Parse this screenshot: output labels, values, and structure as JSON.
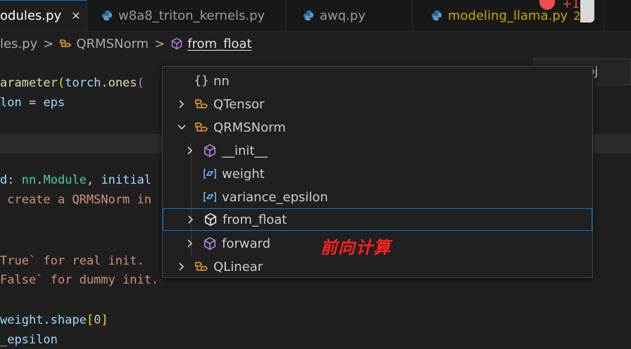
{
  "tabs": [
    {
      "label": "odules.py",
      "active": true,
      "close": "✕"
    },
    {
      "label": "w8a8_triton_kernels.py"
    },
    {
      "label": "awq.py"
    },
    {
      "label": "modeling_llama.py",
      "badge": "2"
    }
  ],
  "notification": {
    "plus": "+1"
  },
  "breadcrumb": {
    "file": "les.py",
    "class": "QRMSNorm",
    "current": "from_float",
    "sep": ">"
  },
  "minimap_label": "oj",
  "code": {
    "l1a": "arameter",
    "l1b": "(",
    "l1c": "torch",
    "l1d": ".",
    "l1e": "ones",
    "l1f": "(",
    "l2a": "lon",
    "l2b": " = ",
    "l2c": "eps",
    "l4a": "d",
    "l4b": ": ",
    "l4c": "nn",
    "l4d": ".",
    "l4e": "Module",
    "l4f": ", ",
    "l4g": "initial",
    "l5": " create a QRMSNorm in",
    "l7": "True` for real init.",
    "l8": "False` for dummy init.",
    "l10a": "weight",
    "l10b": ".",
    "l10c": "shape",
    "l10d": "[",
    "l10e": "0",
    "l10f": "]",
    "l11": "_epsilon"
  },
  "outline": [
    {
      "label": "nn",
      "icon": "namespace-icon",
      "expand": ""
    },
    {
      "label": "QTensor",
      "icon": "class-icon",
      "expand": "collapsed"
    },
    {
      "label": "QRMSNorm",
      "icon": "class-icon",
      "expand": "expanded"
    },
    {
      "label": "__init__",
      "icon": "method-icon",
      "expand": "collapsed"
    },
    {
      "label": "weight",
      "icon": "field-icon",
      "expand": ""
    },
    {
      "label": "variance_epsilon",
      "icon": "field-icon",
      "expand": ""
    },
    {
      "label": "from_float",
      "icon": "method-icon",
      "expand": "collapsed",
      "selected": true
    },
    {
      "label": "forward",
      "icon": "method-icon",
      "expand": "collapsed"
    },
    {
      "label": "QLinear",
      "icon": "class-icon",
      "expand": "collapsed"
    }
  ],
  "annotation": "前向计算",
  "colors": {
    "accent": "#0078d4",
    "class_icon": "#ee9d28",
    "method_icon": "#b180d7",
    "field_icon": "#75beff"
  }
}
